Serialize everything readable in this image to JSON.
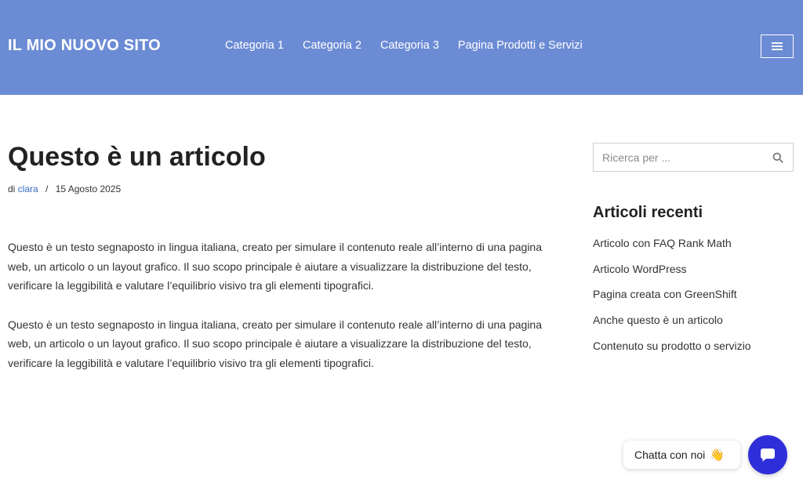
{
  "header": {
    "site_title": "IL MIO NUOVO SITO",
    "nav": [
      {
        "label": "Categoria 1"
      },
      {
        "label": "Categoria 2"
      },
      {
        "label": "Categoria 3"
      },
      {
        "label": "Pagina Prodotti e Servizi"
      }
    ],
    "menu_icon": "hamburger-icon",
    "background_color": "#6b8bd4"
  },
  "post": {
    "title": "Questo è un articolo",
    "meta_prefix": "di",
    "author": "clara",
    "separator": "/",
    "date": "15 Agosto 2025",
    "paragraphs": [
      "Questo è un testo segnaposto in lingua italiana, creato per simulare il contenuto reale all’interno di una pagina web, un articolo o un layout grafico. Il suo scopo principale è aiutare a visualizzare la distribuzione del testo, verificare la leggibilità e valutare l’equilibrio visivo tra gli elementi tipografici.",
      "Questo è un testo segnaposto in lingua italiana, creato per simulare il contenuto reale all’interno di una pagina web, un articolo o un layout grafico. Il suo scopo principale è aiutare a visualizzare la distribuzione del testo, verificare la leggibilità e valutare l’equilibrio visivo tra gli elementi tipografici."
    ]
  },
  "sidebar": {
    "search": {
      "placeholder": "Ricerca per ...",
      "value": "",
      "icon": "search-icon"
    },
    "recent_title": "Articoli recenti",
    "recent_posts": [
      "Articolo con FAQ Rank Math",
      "Articolo WordPress",
      "Pagina creata con GreenShift",
      "Anche questo è un articolo",
      "Contenuto su prodotto o servizio"
    ]
  },
  "chat": {
    "label": "Chatta con noi",
    "emoji": "👋",
    "button_icon": "chat-icon",
    "button_color": "#2f2fd9"
  }
}
